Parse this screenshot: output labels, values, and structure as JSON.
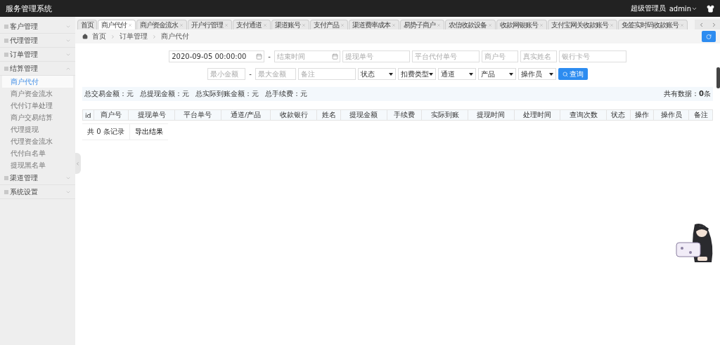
{
  "header": {
    "title": "服务管理系统",
    "user_role": "超级管理员",
    "username": "admin"
  },
  "sidebar": {
    "items": [
      {
        "label": "客户管理",
        "expanded": false
      },
      {
        "label": "代理管理",
        "expanded": false
      },
      {
        "label": "订单管理",
        "expanded": false
      },
      {
        "label": "结算管理",
        "expanded": true,
        "children": [
          {
            "label": "商户代付",
            "selected": true
          },
          {
            "label": "商户资金流水",
            "selected": false
          },
          {
            "label": "代付订单处理",
            "selected": false
          },
          {
            "label": "商户交易结算",
            "selected": false
          },
          {
            "label": "代理提现",
            "selected": false
          },
          {
            "label": "代理资金流水",
            "selected": false
          },
          {
            "label": "代付白名单",
            "selected": false
          },
          {
            "label": "提现黑名单",
            "selected": false
          }
        ]
      },
      {
        "label": "渠道管理",
        "expanded": false
      },
      {
        "label": "系统设置",
        "expanded": false
      }
    ]
  },
  "tabs": [
    {
      "label": "首页",
      "selected": false,
      "closable": false
    },
    {
      "label": "商户代付",
      "selected": true,
      "closable": true
    },
    {
      "label": "商户资金流水",
      "selected": false,
      "closable": true
    },
    {
      "label": "开户行管理",
      "selected": false,
      "closable": true
    },
    {
      "label": "支付通道",
      "selected": false,
      "closable": true
    },
    {
      "label": "渠道账号",
      "selected": false,
      "closable": true
    },
    {
      "label": "支付产品",
      "selected": false,
      "closable": true
    },
    {
      "label": "渠道费率成本",
      "selected": false,
      "closable": true
    },
    {
      "label": "易势子商户",
      "selected": false,
      "closable": true
    },
    {
      "label": "农信收款设备",
      "selected": false,
      "closable": true
    },
    {
      "label": "收款网银账号",
      "selected": false,
      "closable": true
    },
    {
      "label": "支付宝网关收款账号",
      "selected": false,
      "closable": true
    },
    {
      "label": "免签实时码收款账号",
      "selected": false,
      "closable": true
    }
  ],
  "breadcrumb": [
    "首页",
    "订单管理",
    "商户代付"
  ],
  "filters": {
    "row_1": [
      {
        "kind": "date",
        "value": "2020-09-05 00:00:00"
      },
      {
        "kind": "dash",
        "value": "-"
      },
      {
        "kind": "date",
        "placeholder": "结束时间"
      },
      {
        "kind": "text",
        "placeholder": "提现单号"
      },
      {
        "kind": "text",
        "placeholder": "平台代付单号"
      },
      {
        "kind": "text",
        "placeholder": "商户号"
      },
      {
        "kind": "text",
        "placeholder": "真实姓名"
      },
      {
        "kind": "text",
        "placeholder": "银行卡号"
      }
    ],
    "row_2": [
      {
        "kind": "text",
        "placeholder": "最小金额"
      },
      {
        "kind": "dash",
        "value": "-"
      },
      {
        "kind": "text",
        "placeholder": "最大金额"
      },
      {
        "kind": "text",
        "placeholder": "备注"
      },
      {
        "kind": "select",
        "value": "状态"
      },
      {
        "kind": "select",
        "value": "扣费类型"
      },
      {
        "kind": "select",
        "value": "通道"
      },
      {
        "kind": "select",
        "value": "产品"
      },
      {
        "kind": "select",
        "value": "操作员"
      },
      {
        "kind": "button",
        "value": "查询"
      }
    ]
  },
  "summary": {
    "items": [
      "总交易金额：元",
      "总提现金额：元",
      "总实际到账金额：元",
      "总手续费：元"
    ],
    "total_label": "共有数据：",
    "total_count": "0",
    "total_unit": "条"
  },
  "table": {
    "columns": [
      "id",
      "商户号",
      "提现单号",
      "平台单号",
      "通道/产品",
      "收款银行",
      "姓名",
      "提现金额",
      "手续费",
      "实际到账",
      "提现时间",
      "处理时间",
      "查询次数",
      "状态",
      "操作",
      "操作员",
      "备注"
    ]
  },
  "footer": {
    "record_count": "共 0 条记录",
    "export_button": "导出结果"
  }
}
